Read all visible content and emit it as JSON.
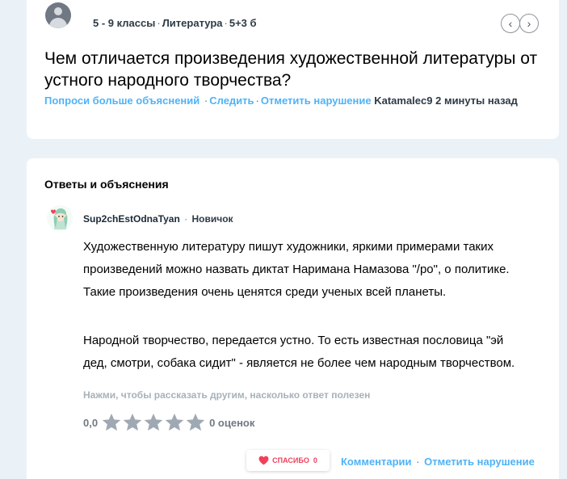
{
  "question": {
    "grade": "5 - 9 классы",
    "subject": "Литература",
    "points": "5+3 б",
    "title": "Чем отличается произведения художественной литературы от устного народного творчества?",
    "actions": {
      "ask_more": "Попроси больше объяснений",
      "follow": "Следить",
      "report": "Отметить нарушение"
    },
    "author": "Katamalec9",
    "time": "2 минуты назад"
  },
  "answers": {
    "heading": "Ответы и объяснения",
    "items": [
      {
        "username": "Sup2chEstOdnaTyan",
        "rank": "Новичок",
        "paragraphs": [
          "Художественную литературу пишут художники, яркими примерами таких\nпроизведений можно назвать диктат Наримана Намазова \"/ро\", о политике.\nТакие произведения очень ценятся среди ученых всей планеты.",
          "Народной творчество, передается устно. То есть известная пословица \"эй\nдед, смотри, собака сидит\" - является не более чем народным творчеством."
        ],
        "helpful_prompt": "Нажми, чтобы рассказать другим, насколько ответ полезен",
        "rating_value": "0,0",
        "rating_stars": 0,
        "rating_count": "0 оценок",
        "thanks_label": "СПАСИБО",
        "thanks_count": "0",
        "comments_label": "Комментарии",
        "report_label": "Отметить нарушение"
      }
    ]
  },
  "icons": {
    "prev": "chevron-left-icon",
    "next": "chevron-right-icon",
    "heart": "heart-icon",
    "star": "star-icon"
  },
  "colors": {
    "link": "#4fb3f6",
    "star_empty": "#9fa9b3",
    "heart": "#f2405b",
    "background": "#ebf2f7"
  }
}
